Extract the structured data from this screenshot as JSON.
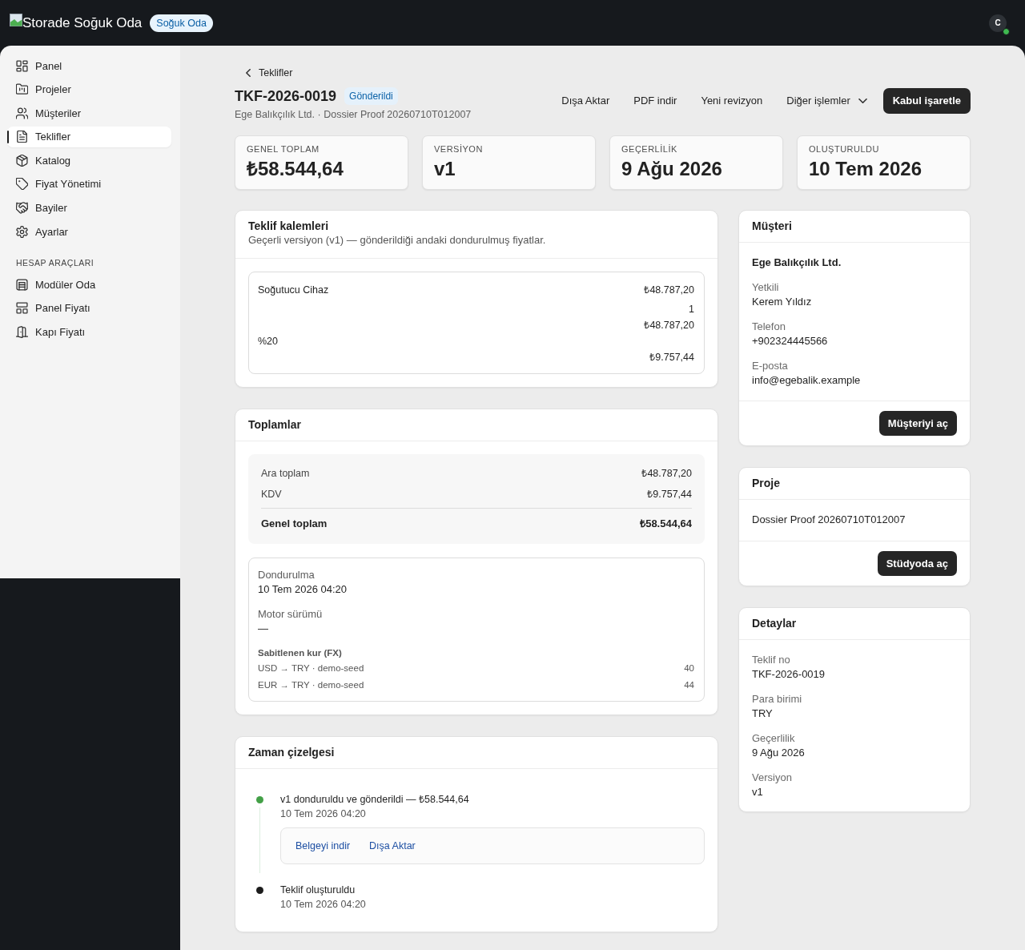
{
  "top_bar": {
    "brand": "Storade Soğuk Oda",
    "workspace_badge": "Soğuk Oda",
    "avatar_initial": "C",
    "avatar_online": true
  },
  "sidebar": {
    "items": [
      {
        "label": "Panel",
        "selected": false
      },
      {
        "label": "Projeler",
        "selected": false
      },
      {
        "label": "Müşteriler",
        "selected": false
      },
      {
        "label": "Teklifler",
        "selected": true
      },
      {
        "label": "Katalog",
        "selected": false
      },
      {
        "label": "Fiyat Yönetimi",
        "selected": false
      },
      {
        "label": "Bayiler",
        "selected": false
      },
      {
        "label": "Ayarlar",
        "selected": false
      }
    ],
    "section": {
      "title": "HESAP ARAÇLARI",
      "items": [
        {
          "label": "Modüler Oda",
          "selected": false
        },
        {
          "label": "Panel Fiyatı",
          "selected": false
        },
        {
          "label": "Kapı Fiyatı",
          "selected": false
        }
      ]
    }
  },
  "header": {
    "back_link": "Teklifler",
    "title": "TKF-2026-0019",
    "status": "Gönderildi",
    "subtitle": "Ege Balıkçılık Ltd. · Dossier Proof 20260710T012007",
    "actions": [
      {
        "label": "Dışa Aktar",
        "kind": "ghost"
      },
      {
        "label": "PDF indir",
        "kind": "ghost"
      },
      {
        "label": "Yeni revizyon",
        "kind": "ghost"
      },
      {
        "label": "Diğer işlemler",
        "kind": "menu"
      },
      {
        "label": "Kabul işaretle",
        "kind": "primary"
      }
    ]
  },
  "stats": [
    {
      "label": "GENEL TOPLAM",
      "value": "₺58.544,64"
    },
    {
      "label": "VERSİYON",
      "value": "v1"
    },
    {
      "label": "GEÇERLİLİK",
      "value": "9 Ağu 2026"
    },
    {
      "label": "OLUŞTURULDU",
      "value": "10 Tem 2026"
    }
  ],
  "line_items_card": {
    "title": "Teklif kalemleri",
    "subtitle": "Geçerli versiyon (v1) — gönderildiği andaki dondurulmuş fiyatlar.",
    "items": [
      {
        "name": "Soğutucu Cihaz",
        "unit_price": "₺48.787,20",
        "quantity": "1",
        "line_total": "₺48.787,20",
        "vat_rate": "%20",
        "vat_amount": "₺9.757,44"
      }
    ]
  },
  "totals_card": {
    "title": "Toplamlar",
    "rows": [
      {
        "label": "Ara toplam",
        "value": "₺48.787,20",
        "kind": "line"
      },
      {
        "label": "KDV",
        "value": "₺9.757,44",
        "kind": "line"
      },
      {
        "label": "Genel toplam",
        "value": "₺58.544,64",
        "kind": "grand"
      }
    ],
    "freeze_fields": [
      {
        "label": "Dondurulma",
        "value": "10 Tem 2026 04:20"
      },
      {
        "label": "Motor sürümü",
        "value": "—"
      }
    ],
    "fx_title": "Sabitlenen kur (FX)",
    "fx_rates": [
      {
        "pair": "USD → TRY · demo-seed",
        "rate": "40"
      },
      {
        "pair": "EUR → TRY · demo-seed",
        "rate": "44"
      }
    ]
  },
  "timeline_card": {
    "title": "Zaman çizelgesi",
    "events": [
      {
        "text": "v1 donduruldu ve gönderildi — ₺58.544,64",
        "time": "10 Tem 2026 04:20",
        "color": "#43a047",
        "links": [
          "Belgeyi indir",
          "Dışa Aktar"
        ]
      },
      {
        "text": "Teklif oluşturuldu",
        "time": "10 Tem 2026 04:20",
        "color": "#1c1c1c"
      }
    ]
  },
  "customer_card": {
    "title": "Müşteri",
    "name": "Ege Balıkçılık Ltd.",
    "fields": [
      {
        "label": "Yetkili",
        "value": "Kerem Yıldız"
      },
      {
        "label": "Telefon",
        "value": "+902324445566"
      },
      {
        "label": "E-posta",
        "value": "info@egebalik.example"
      }
    ],
    "button": "Müşteriyi aç"
  },
  "project_card": {
    "title": "Proje",
    "name": "Dossier Proof 20260710T012007",
    "button": "Stüdyoda aç"
  },
  "details_card": {
    "title": "Detaylar",
    "fields": [
      {
        "label": "Teklif no",
        "value": "TKF-2026-0019"
      },
      {
        "label": "Para birimi",
        "value": "TRY"
      },
      {
        "label": "Geçerlilik",
        "value": "9 Ağu 2026"
      },
      {
        "label": "Versiyon",
        "value": "v1"
      }
    ]
  }
}
